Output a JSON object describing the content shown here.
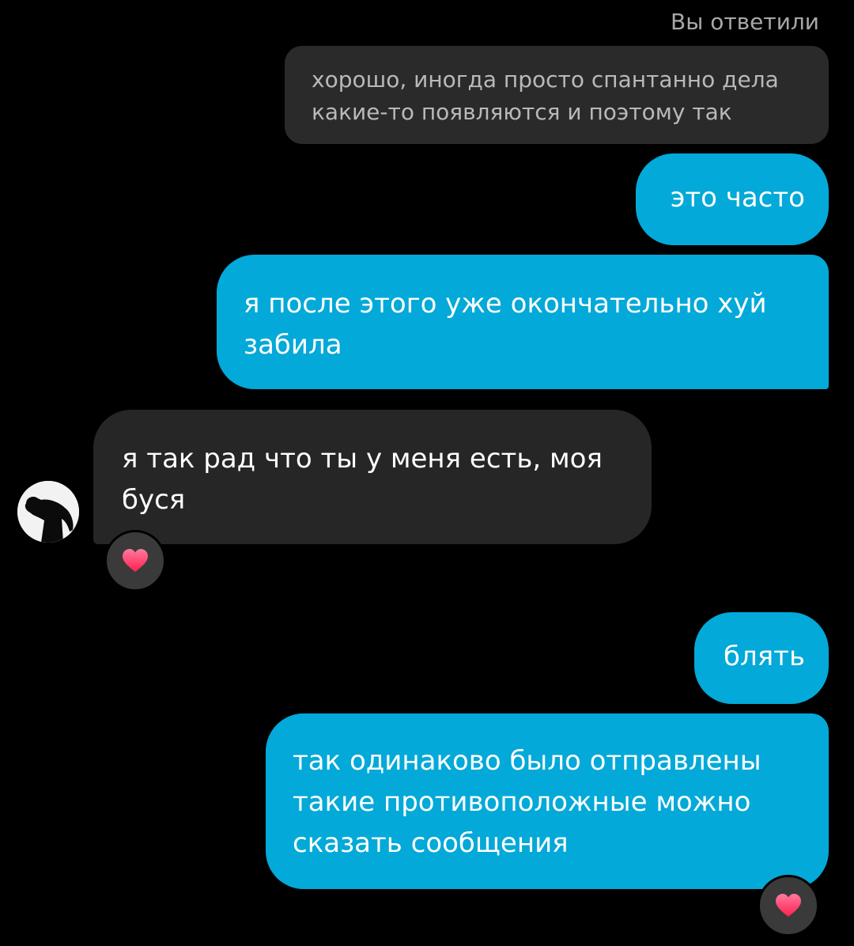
{
  "reply": {
    "label": "Вы ответили",
    "quoted_text": "хорошо, иногда просто спантанно дела какие-то появляются и поэтому так"
  },
  "messages": [
    {
      "side": "outgoing",
      "text": "это часто"
    },
    {
      "side": "outgoing",
      "text": "я после этого уже окончательно хуй\nзабила"
    },
    {
      "side": "incoming",
      "text": "я так рад что ты у меня есть, моя\nбуся",
      "reaction": "heart-icon"
    },
    {
      "side": "outgoing",
      "text": "блять"
    },
    {
      "side": "outgoing",
      "text": "так одинаково было отправлены\nтакие противоположные можно\nсказать сообщения",
      "reaction": "heart-icon"
    }
  ],
  "colors": {
    "background": "#000000",
    "outgoing_bubble": "#03a9d8",
    "incoming_bubble": "#262626",
    "quoted_bubble": "#2a2a2a",
    "reaction_badge": "#3a3a3a",
    "heart": "#ff2d55"
  }
}
